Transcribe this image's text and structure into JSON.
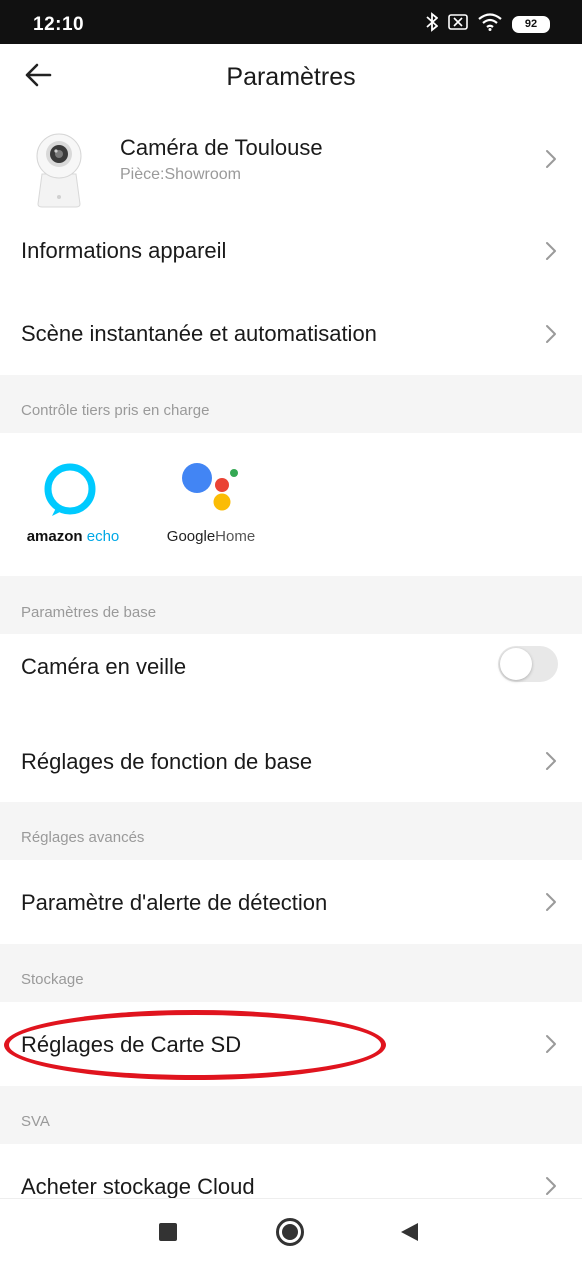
{
  "status_bar": {
    "time": "12:10",
    "battery": "92",
    "icons": [
      "bluetooth-icon",
      "sim-off-icon",
      "wifi-icon",
      "battery-icon"
    ]
  },
  "header": {
    "title": "Paramètres",
    "back_icon": "arrow-left-icon"
  },
  "device": {
    "name": "Caméra de Toulouse",
    "room": "Pièce:Showroom",
    "image_icon": "camera-icon"
  },
  "rows": {
    "device_info": "Informations appareil",
    "scene": "Scène instantanée et automatisation",
    "standby": "Caméra en veille",
    "basic_functions": "Réglages de fonction de base",
    "detection_alert": "Paramètre d'alerte de détection",
    "sd_card": "Réglages de Carte SD",
    "cloud": "Acheter stockage Cloud"
  },
  "sections": {
    "third_party": "Contrôle tiers pris en charge",
    "basic": "Paramètres de base",
    "advanced": "Réglages avancés",
    "storage": "Stockage",
    "sva": "SVA"
  },
  "third_party": {
    "alexa_label_bold": "amazon",
    "alexa_label_light": "echo",
    "google_label_bold": "Google",
    "google_label_light": "Home"
  },
  "toggles": {
    "standby_on": false
  },
  "colors": {
    "alexa_blue": "#00caff",
    "google_blue": "#4285f4",
    "google_red": "#ea4335",
    "google_yellow": "#fbbc05",
    "google_green": "#34a853",
    "highlight_red": "#e0141e",
    "section_bg": "#f5f5f5"
  },
  "nav_bar": {
    "icons": [
      "recent-apps-icon",
      "home-icon",
      "back-icon"
    ]
  }
}
